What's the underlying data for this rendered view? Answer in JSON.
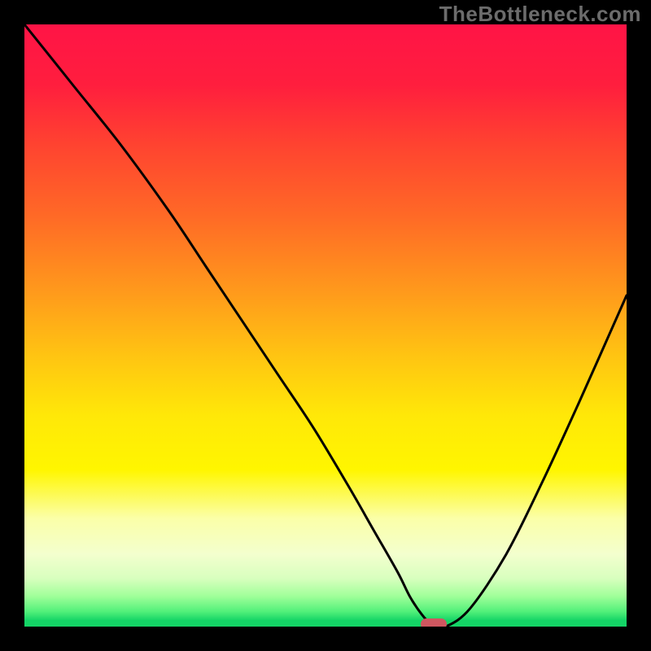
{
  "watermark": "TheBottleneck.com",
  "colors": {
    "frame_bg": "#000000",
    "marker": "#cf5760",
    "curve": "#000000"
  },
  "chart_data": {
    "type": "line",
    "title": "",
    "xlabel": "",
    "ylabel": "",
    "xlim": [
      0,
      100
    ],
    "ylim": [
      0,
      100
    ],
    "x": [
      0,
      8,
      16,
      24,
      30,
      36,
      42,
      48,
      54,
      58,
      62,
      64,
      66,
      68,
      70,
      74,
      80,
      86,
      92,
      100
    ],
    "values": [
      100,
      90,
      80,
      69,
      60,
      51,
      42,
      33,
      23,
      16,
      9,
      5,
      2,
      0,
      0,
      3,
      12,
      24,
      37,
      55
    ],
    "marker_x": 68,
    "marker_y": 0,
    "gradient_stops": [
      {
        "pct": 0,
        "color": "#ff1446"
      },
      {
        "pct": 32,
        "color": "#ff6a26"
      },
      {
        "pct": 55,
        "color": "#ffc412"
      },
      {
        "pct": 74,
        "color": "#fff600"
      },
      {
        "pct": 88,
        "color": "#f3ffce"
      },
      {
        "pct": 100,
        "color": "#14d466"
      }
    ]
  }
}
